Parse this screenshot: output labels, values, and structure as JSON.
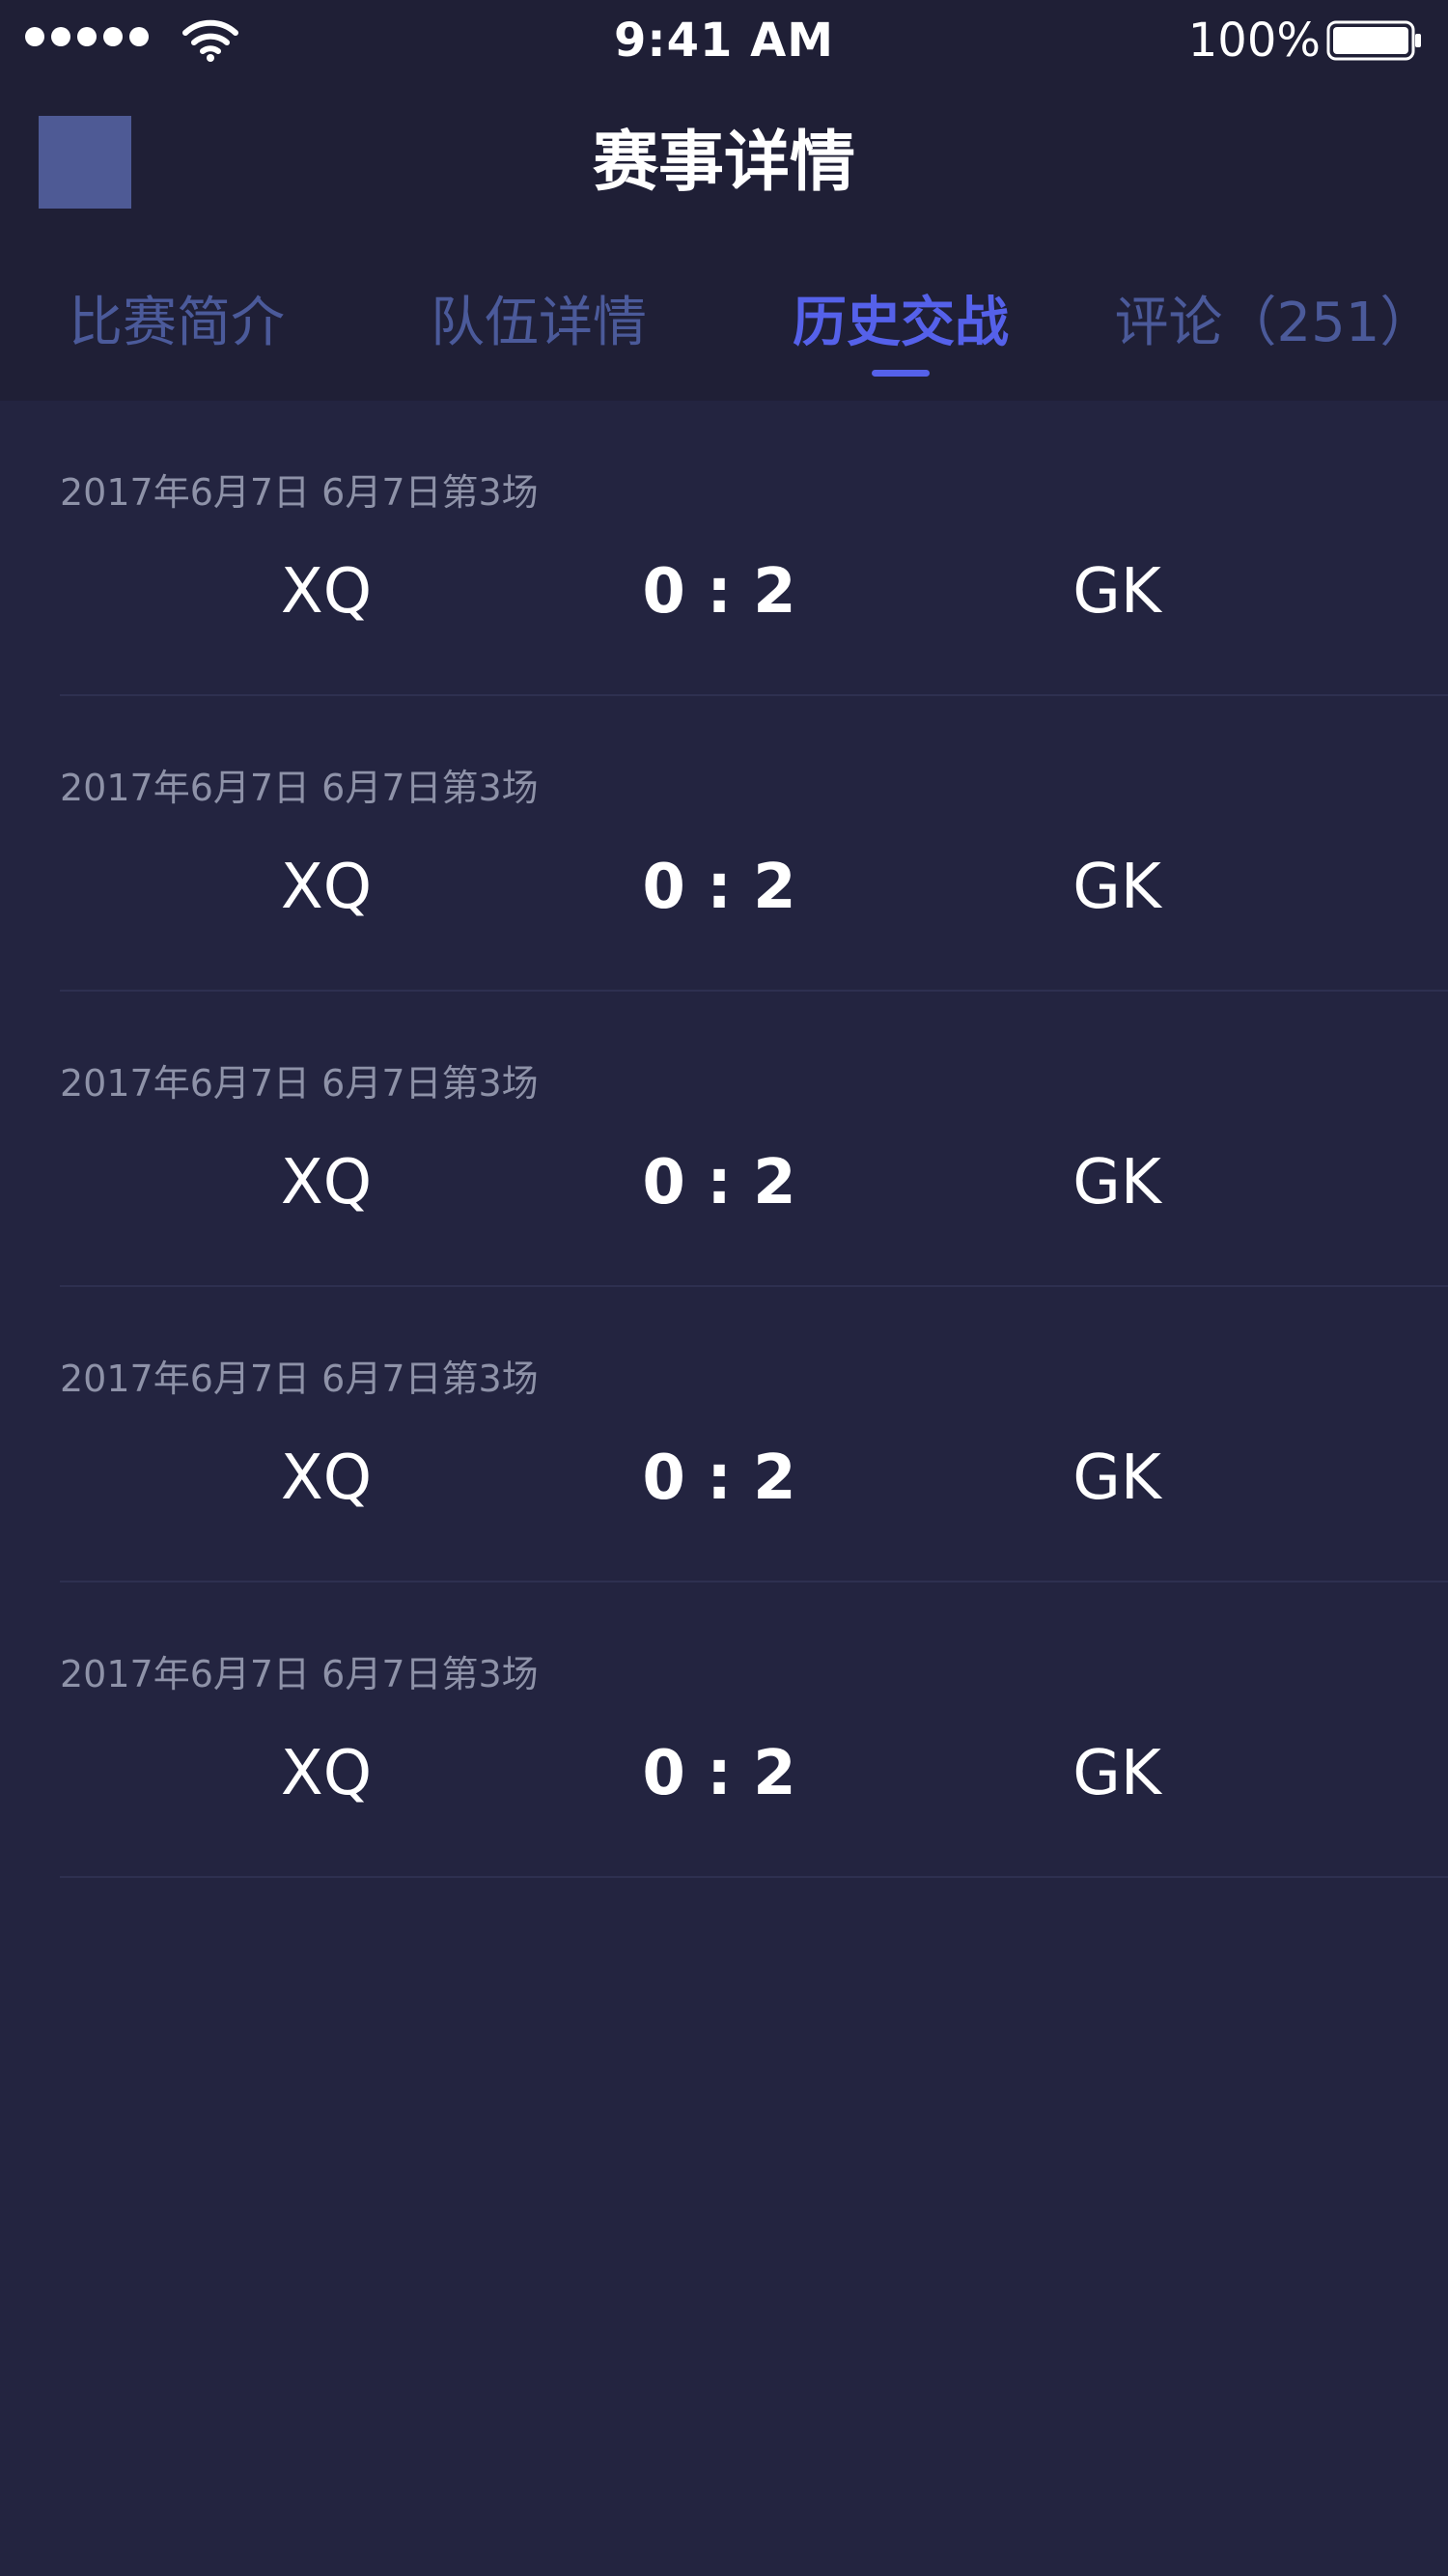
{
  "status_bar": {
    "time": "9:41 AM",
    "battery": "100%",
    "icons": [
      "signal-dots-icon",
      "wifi-icon",
      "battery-icon"
    ]
  },
  "nav": {
    "title": "赛事详情",
    "back_icon": "back-placeholder-icon"
  },
  "tabs": [
    {
      "label": "比赛简介",
      "active": false
    },
    {
      "label": "队伍详情",
      "active": false
    },
    {
      "label": "历史交战",
      "active": true
    },
    {
      "label": "评论（251）",
      "active": false
    }
  ],
  "matches": [
    {
      "date": "2017年6月7日 6月7日第3场",
      "home": "XQ",
      "score": "0 : 2",
      "away": "GK"
    },
    {
      "date": "2017年6月7日 6月7日第3场",
      "home": "XQ",
      "score": "0 : 2",
      "away": "GK"
    },
    {
      "date": "2017年6月7日 6月7日第3场",
      "home": "XQ",
      "score": "0 : 2",
      "away": "GK"
    },
    {
      "date": "2017年6月7日 6月7日第3场",
      "home": "XQ",
      "score": "0 : 2",
      "away": "GK"
    },
    {
      "date": "2017年6月7日 6月7日第3场",
      "home": "XQ",
      "score": "0 : 2",
      "away": "GK"
    }
  ],
  "colors": {
    "header_bg": "#1f1f36",
    "body_bg": "#232440",
    "tab_inactive": "#4b5a9a",
    "tab_active": "#5561ea",
    "date_text": "#8e92a8"
  }
}
